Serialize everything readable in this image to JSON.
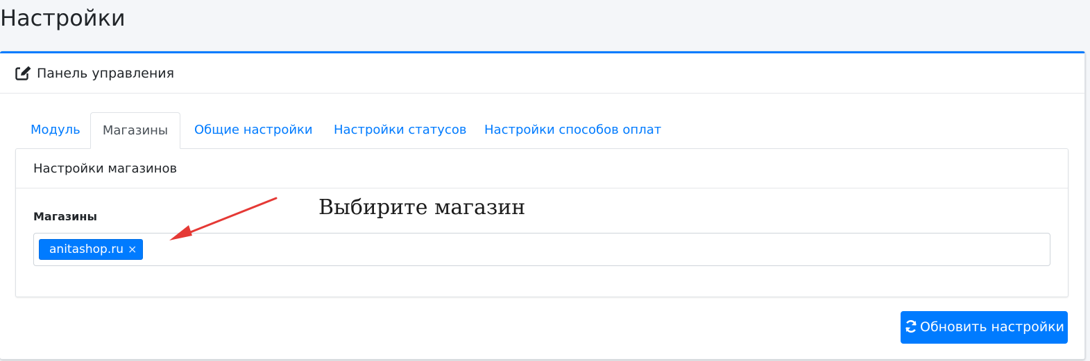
{
  "page": {
    "title": "Настройки"
  },
  "panel": {
    "header_icon": "edit-icon",
    "header_title": "Панель управления"
  },
  "tabs": [
    {
      "label": "Модуль",
      "active": false
    },
    {
      "label": "Магазины",
      "active": true
    },
    {
      "label": "Общие настройки",
      "active": false
    },
    {
      "label": "Настройки статусов",
      "active": false
    },
    {
      "label": "Настройки способов оплат",
      "active": false
    }
  ],
  "shops_card": {
    "title": "Настройки магазинов",
    "field_label": "Магазины",
    "selected_shops": [
      {
        "label": "anitashop.ru",
        "remove_symbol": "×"
      }
    ]
  },
  "annotation": {
    "text": "Выбирите магазин",
    "arrow_color": "#e53935"
  },
  "actions": {
    "update_icon": "refresh-icon",
    "update_label": "Обновить настройки"
  },
  "colors": {
    "accent": "#007bff",
    "background": "#f4f6f9",
    "card": "#ffffff"
  }
}
